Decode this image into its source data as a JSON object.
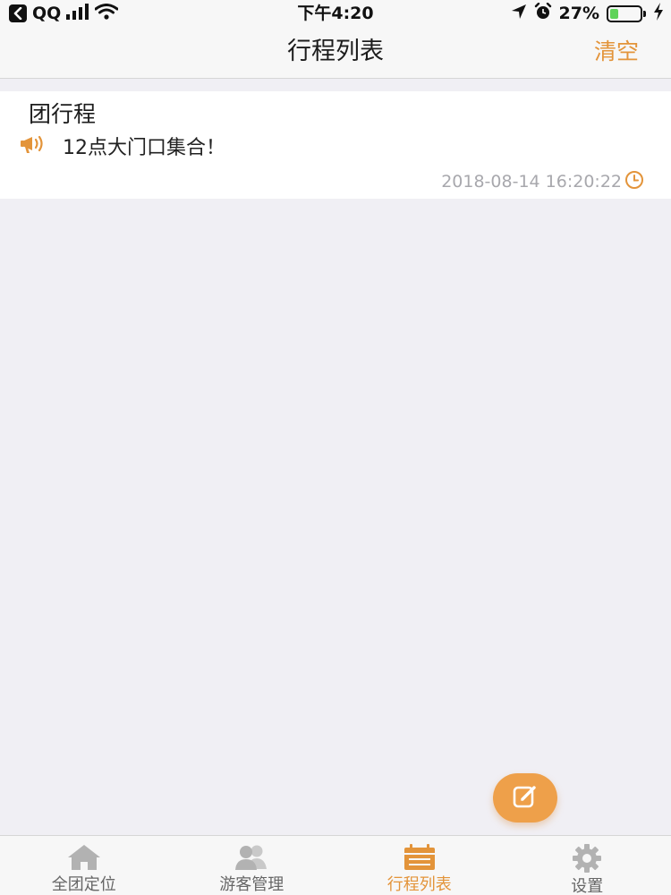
{
  "status_bar": {
    "back_app": "QQ",
    "time": "下午4:20",
    "battery": "27%",
    "battery_level": 0.27
  },
  "nav": {
    "title": "行程列表",
    "action": "清空"
  },
  "itinerary": [
    {
      "title": "团行程",
      "message": "12点大门口集合！",
      "time": "2018-08-14 16:20:22"
    }
  ],
  "tabs": [
    {
      "label": "全团定位",
      "icon": "home-icon",
      "active": false
    },
    {
      "label": "游客管理",
      "icon": "users-icon",
      "active": false
    },
    {
      "label": "行程列表",
      "icon": "calendar-icon",
      "active": true
    },
    {
      "label": "设置",
      "icon": "gear-icon",
      "active": false
    }
  ],
  "colors": {
    "accent": "#e3943a",
    "fab": "#eea04a",
    "background": "#f0eff4",
    "inactive_icon": "#b2b2b2"
  }
}
